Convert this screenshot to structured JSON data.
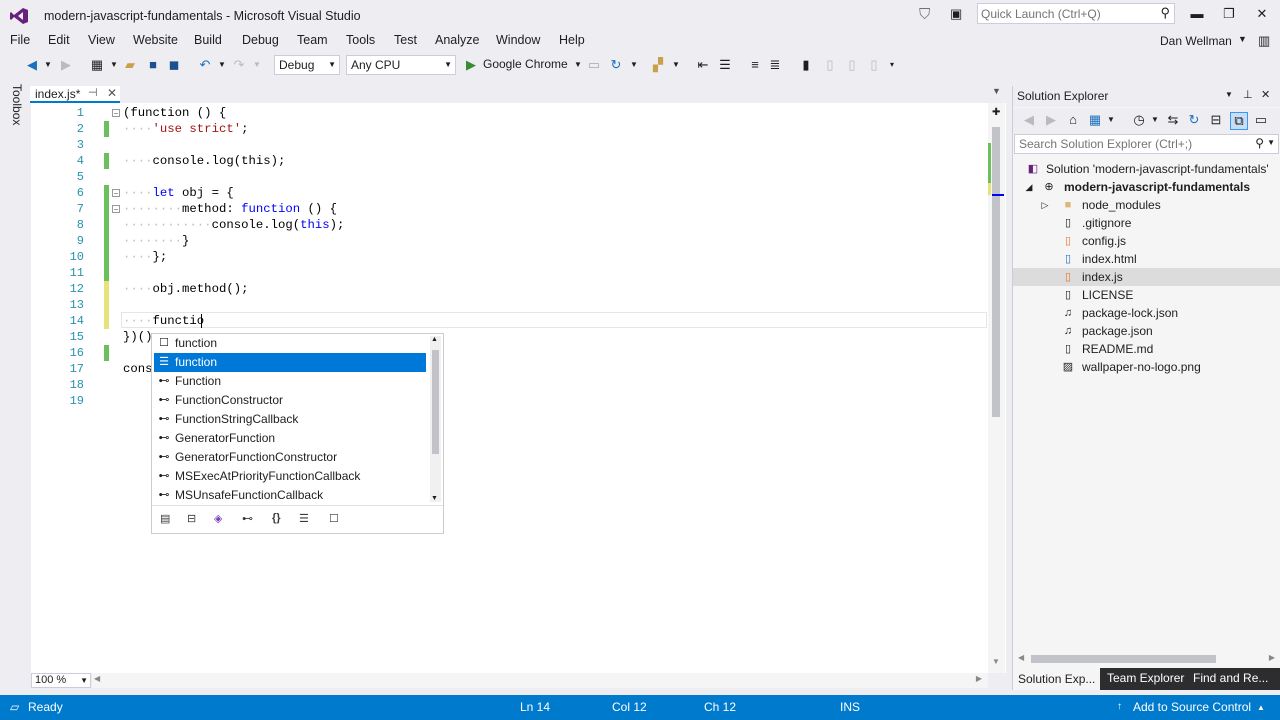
{
  "window": {
    "title": "modern-javascript-fundamentals - Microsoft Visual Studio",
    "quick_launch_placeholder": "Quick Launch (Ctrl+Q)",
    "controls": {
      "minimize": "▬",
      "restore": "❐",
      "close": "✕"
    }
  },
  "menu": {
    "items": [
      "File",
      "Edit",
      "View",
      "Website",
      "Build",
      "Debug",
      "Team",
      "Tools",
      "Test",
      "Analyze",
      "Window",
      "Help"
    ],
    "user": "Dan Wellman"
  },
  "toolbar": {
    "configuration": "Debug",
    "platform": "Any CPU",
    "run_target": "Google Chrome"
  },
  "toolbox": {
    "label": "Toolbox"
  },
  "editor": {
    "tab_label": "index.js*",
    "zoom": "100 %",
    "line_numbers": [
      "1",
      "2",
      "3",
      "4",
      "5",
      "6",
      "7",
      "8",
      "9",
      "10",
      "11",
      "12",
      "13",
      "14",
      "15",
      "16",
      "17",
      "18",
      "19"
    ],
    "code": {
      "l1": "(function () {",
      "l2_str": "'use strict'",
      "l2_semi": ";",
      "l4": "console.log(this);",
      "l6_kw": "let",
      "l6_rest": " obj = {",
      "l7_a": "method: ",
      "l7_kw": "function",
      "l7_b": " () {",
      "l8_a": "console.log(",
      "l8_kw": "this",
      "l8_b": ");",
      "l9": "}",
      "l10": "};",
      "l12": "obj.method();",
      "l14": "functio",
      "l15": "})()",
      "l17": "cons"
    }
  },
  "completion": {
    "items": [
      {
        "icon": "keyword-snippet-icon",
        "label": "function",
        "selected": false
      },
      {
        "icon": "keyword-icon",
        "label": "function",
        "selected": true
      },
      {
        "icon": "interface-icon",
        "label": "Function",
        "selected": false
      },
      {
        "icon": "interface-icon",
        "label": "FunctionConstructor",
        "selected": false
      },
      {
        "icon": "interface-icon",
        "label": "FunctionStringCallback",
        "selected": false
      },
      {
        "icon": "interface-icon",
        "label": "GeneratorFunction",
        "selected": false
      },
      {
        "icon": "interface-icon",
        "label": "GeneratorFunctionConstructor",
        "selected": false
      },
      {
        "icon": "interface-icon",
        "label": "MSExecAtPriorityFunctionCallback",
        "selected": false
      },
      {
        "icon": "interface-icon",
        "label": "MSUnsafeFunctionCallback",
        "selected": false
      }
    ]
  },
  "solution_explorer": {
    "title": "Solution Explorer",
    "search_placeholder": "Search Solution Explorer (Ctrl+;)",
    "solution_label": "Solution 'modern-javascript-fundamentals'",
    "project_label": "modern-javascript-fundamentals",
    "items": [
      {
        "label": "node_modules",
        "icon": "folder-icon",
        "selected": false
      },
      {
        "label": ".gitignore",
        "icon": "file-icon",
        "selected": false
      },
      {
        "label": "config.js",
        "icon": "js-file-icon",
        "selected": false
      },
      {
        "label": "index.html",
        "icon": "html-file-icon",
        "selected": false
      },
      {
        "label": "index.js",
        "icon": "js-file-icon",
        "selected": true
      },
      {
        "label": "LICENSE",
        "icon": "file-icon",
        "selected": false
      },
      {
        "label": "package-lock.json",
        "icon": "json-file-icon",
        "selected": false
      },
      {
        "label": "package.json",
        "icon": "json-file-icon",
        "selected": false
      },
      {
        "label": "README.md",
        "icon": "file-icon",
        "selected": false
      },
      {
        "label": "wallpaper-no-logo.png",
        "icon": "image-file-icon",
        "selected": false
      }
    ],
    "tabs": [
      "Solution Exp...",
      "Team Explorer",
      "Find and Re..."
    ]
  },
  "statusbar": {
    "state": "Ready",
    "line": "Ln 14",
    "col": "Col 12",
    "ch": "Ch 12",
    "mode": "INS",
    "source_control": "Add to Source Control"
  },
  "colors": {
    "accent": "#007acc",
    "selection": "#0078d7",
    "keyword": "#0000ff",
    "string": "#a31515",
    "line_number": "#2b91af"
  }
}
